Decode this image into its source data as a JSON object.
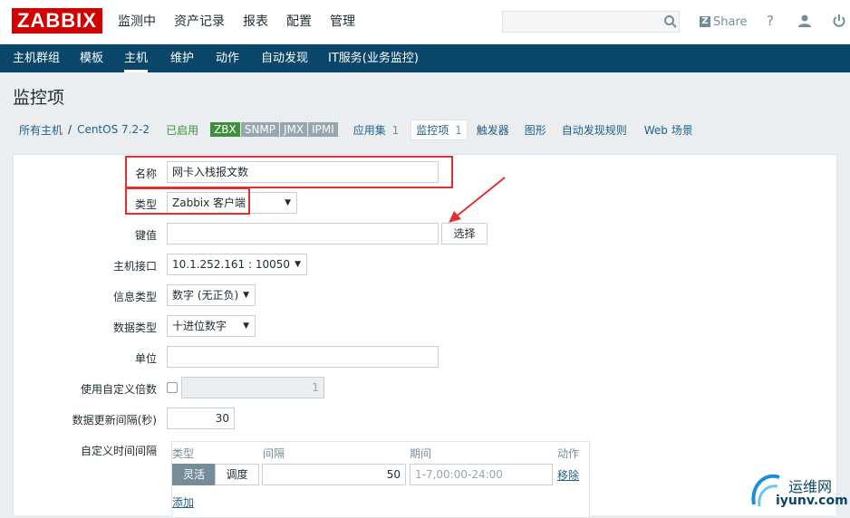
{
  "app": {
    "logo": "ZABBIX"
  },
  "top_menu": [
    "监测中",
    "资产记录",
    "报表",
    "配置",
    "管理"
  ],
  "top_right": {
    "share": "Share",
    "help_icon": "?",
    "user_icon": "user-icon",
    "logout_icon": "power-icon"
  },
  "sub_menu": [
    "主机群组",
    "模板",
    "主机",
    "维护",
    "动作",
    "自动发现",
    "IT服务(业务监控)"
  ],
  "page_title": "监控项",
  "breadcrumb": {
    "all_hosts": "所有主机",
    "sep": "/",
    "host": "CentOS 7.2-2",
    "enabled": "已启用",
    "tags": [
      "ZBX",
      "SNMP",
      "JMX",
      "IPMI"
    ],
    "apps": "应用集",
    "apps_count": "1",
    "items": "监控项",
    "items_count": "1",
    "triggers": "触发器",
    "graphs": "图形",
    "discovery": "自动发现规则",
    "web": "Web 场景"
  },
  "form": {
    "name_label": "名称",
    "name_value": "网卡入栈报文数",
    "type_label": "类型",
    "type_value": "Zabbix 客户端",
    "key_label": "键值",
    "key_value": "",
    "select_button": "选择",
    "interface_label": "主机接口",
    "interface_value": "10.1.252.161 : 10050",
    "info_type_label": "信息类型",
    "info_type_value": "数字 (无正负)",
    "data_type_label": "数据类型",
    "data_type_value": "十进位数字",
    "units_label": "单位",
    "units_value": "",
    "multiplier_label": "使用自定义倍数",
    "multiplier_value": "1",
    "update_label": "数据更新间隔(秒)",
    "update_value": "30",
    "custom_label": "自定义时间间隔",
    "intervals": {
      "col_type": "类型",
      "col_interval": "间隔",
      "col_period": "期间",
      "col_action": "动作",
      "flexible": "灵活",
      "scheduling": "调度",
      "interval_value": "50",
      "period_value": "1-7,00:00-24:00",
      "remove": "移除",
      "add": "添加"
    }
  },
  "watermark": {
    "cn": "运维网",
    "url": "iyunv.com"
  },
  "colors": {
    "topbar": "#ffffff",
    "subbar": "#0a466a",
    "logo": "#d40000",
    "highlight": "#e23030",
    "zbx_tag": "#3f8f3f"
  }
}
